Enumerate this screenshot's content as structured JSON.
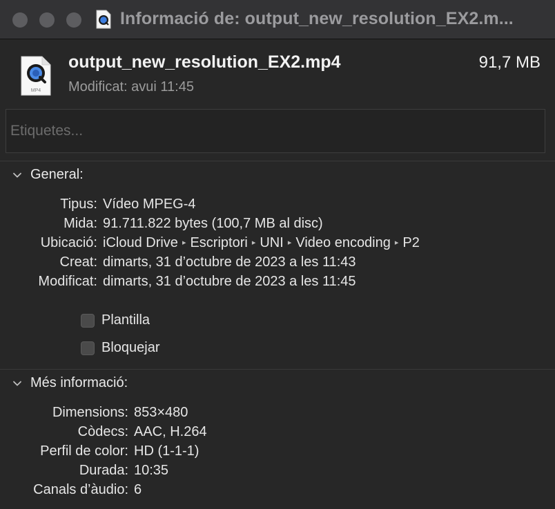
{
  "window": {
    "title": "Informació de: output_new_resolution_EX2.m..."
  },
  "header": {
    "file_name": "output_new_resolution_EX2.mp4",
    "file_size": "91,7 MB",
    "modified": "Modificat: avui 11:45",
    "icon_badge": "MP4"
  },
  "tags": {
    "placeholder": "Etiquetes..."
  },
  "general": {
    "heading": "General:",
    "rows": [
      {
        "label": "Tipus:",
        "value": "Vídeo MPEG-4"
      },
      {
        "label": "Mida:",
        "value": "91.711.822 bytes (100,7 MB al disc)"
      },
      {
        "label": "Creat:",
        "value": "dimarts, 31 d’octubre de 2023 a les 11:43"
      },
      {
        "label": "Modificat:",
        "value": "dimarts, 31 d’octubre de 2023 a les 11:45"
      }
    ],
    "location": {
      "label": "Ubicació:",
      "path": [
        "iCloud Drive",
        "Escriptori",
        "UNI",
        "Video encoding",
        "P2"
      ],
      "separator": "▸"
    },
    "checkboxes": [
      {
        "label": "Plantilla",
        "checked": false
      },
      {
        "label": "Bloquejar",
        "checked": false
      }
    ]
  },
  "more_info": {
    "heading": "Més informació:",
    "rows": [
      {
        "label": "Dimensions:",
        "value": "853×480"
      },
      {
        "label": "Còdecs:",
        "value": "AAC, H.264"
      },
      {
        "label": "Perfil de color:",
        "value": "HD (1-1-1)"
      },
      {
        "label": "Durada:",
        "value": "10:35"
      },
      {
        "label": "Canals d’àudio:",
        "value": "6"
      }
    ]
  }
}
